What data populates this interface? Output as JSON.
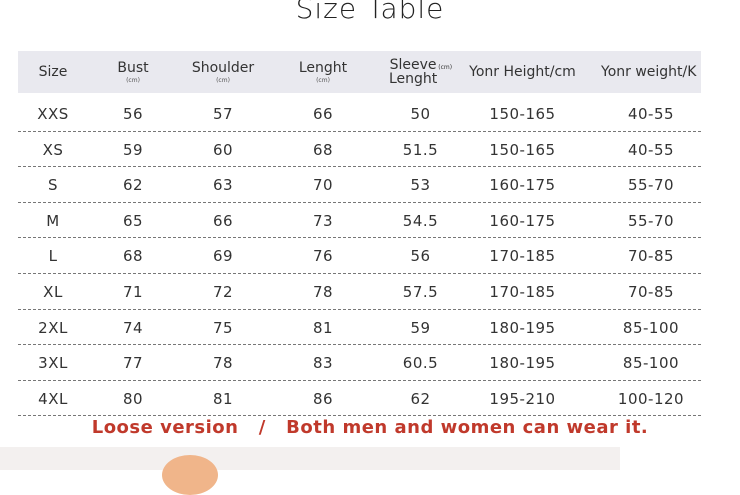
{
  "title": "Size Table",
  "columns": [
    {
      "label": "Size",
      "unit": ""
    },
    {
      "label": "Bust",
      "unit": "(cm)"
    },
    {
      "label": "Shoulder",
      "unit": "(cm)"
    },
    {
      "label": "Lenght",
      "unit": "(cm)"
    },
    {
      "label_line1": "Sleeve",
      "label_line2": "Lenght",
      "unit": "(cm)"
    },
    {
      "label": "Yonr Height/cm",
      "unit": ""
    },
    {
      "label": "Yonr weight/K",
      "unit": ""
    }
  ],
  "rows": [
    [
      "XXS",
      "56",
      "57",
      "66",
      "50",
      "150-165",
      "40-55"
    ],
    [
      "XS",
      "59",
      "60",
      "68",
      "51.5",
      "150-165",
      "40-55"
    ],
    [
      "S",
      "62",
      "63",
      "70",
      "53",
      "160-175",
      "55-70"
    ],
    [
      "M",
      "65",
      "66",
      "73",
      "54.5",
      "160-175",
      "55-70"
    ],
    [
      "L",
      "68",
      "69",
      "76",
      "56",
      "170-185",
      "70-85"
    ],
    [
      "XL",
      "71",
      "72",
      "78",
      "57.5",
      "170-185",
      "70-85"
    ],
    [
      "2XL",
      "74",
      "75",
      "81",
      "59",
      "180-195",
      "85-100"
    ],
    [
      "3XL",
      "77",
      "78",
      "83",
      "60.5",
      "180-195",
      "85-100"
    ],
    [
      "4XL",
      "80",
      "81",
      "86",
      "62",
      "195-210",
      "100-120"
    ]
  ],
  "note": "Loose version   /   Both men and women can wear it.",
  "colors": {
    "header_bg": "#e9e9ef",
    "note": "#c0392b",
    "photo_skin": "#f0b58a"
  }
}
